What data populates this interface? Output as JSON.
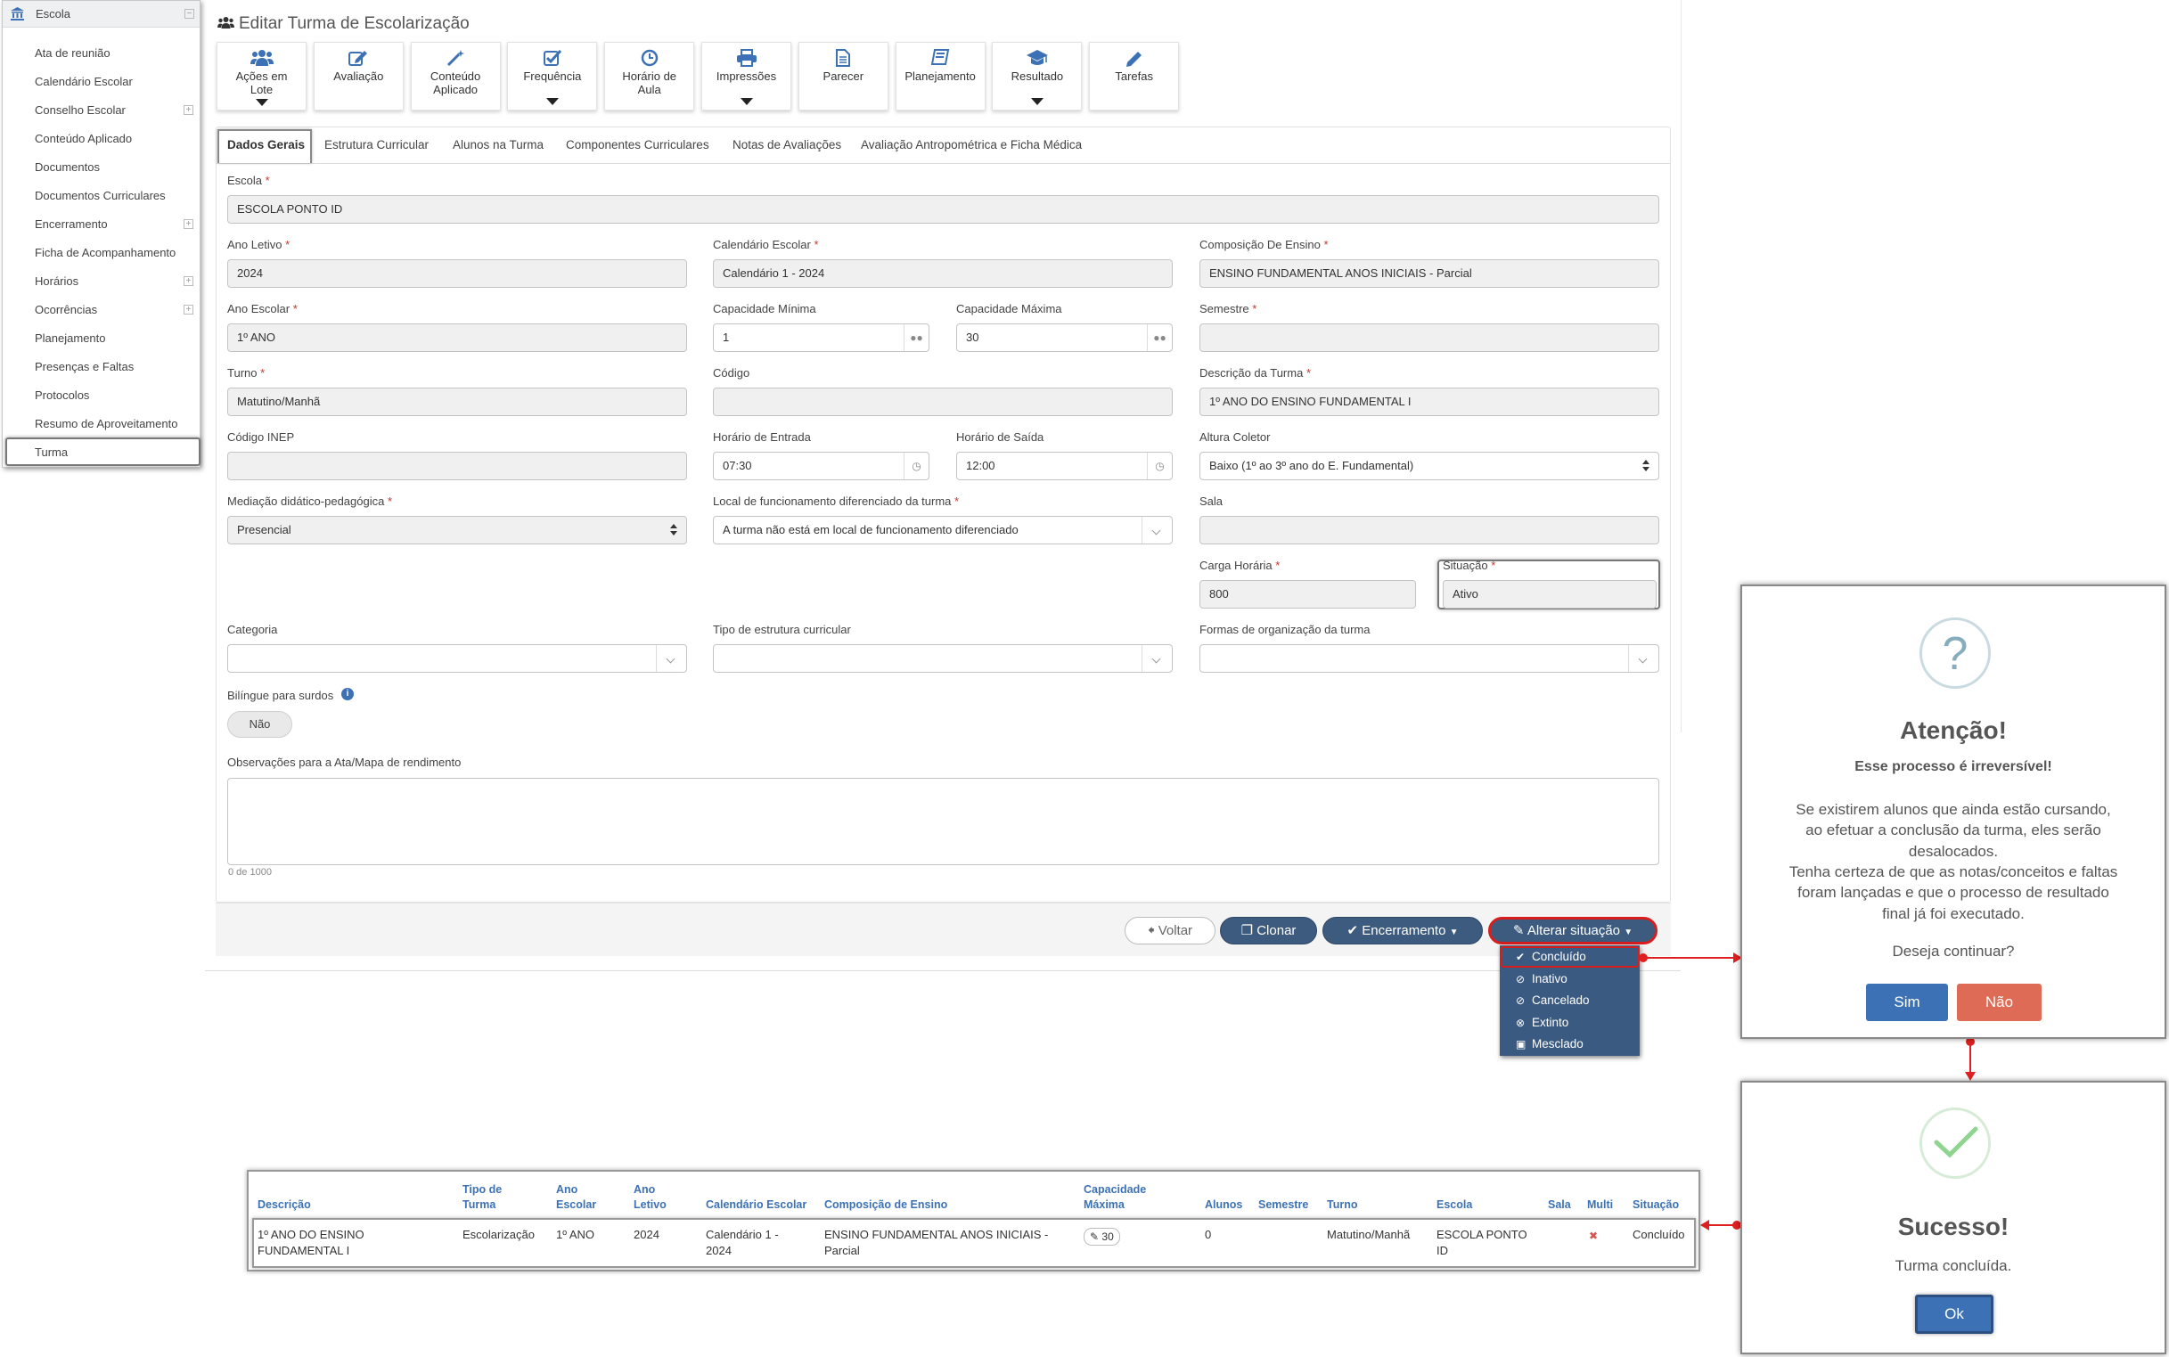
{
  "sidebar": {
    "header": "Escola",
    "items": [
      "Ata de reunião",
      "Calendário Escolar",
      "Conselho Escolar",
      "Conteúdo Aplicado",
      "Documentos",
      "Documentos Curriculares",
      "Encerramento",
      "Ficha de Acompanhamento",
      "Horários",
      "Ocorrências",
      "Planejamento",
      "Presenças e Faltas",
      "Protocolos",
      "Resumo de Aproveitamento",
      "Turma"
    ],
    "expandable": [
      "Conselho Escolar",
      "Encerramento",
      "Horários",
      "Ocorrências"
    ],
    "active": "Turma"
  },
  "page": {
    "title": "Editar Turma de Escolarização"
  },
  "toolbar": [
    {
      "l1": "Ações em",
      "l2": "Lote",
      "icon": "users-icon",
      "caret": true
    },
    {
      "l1": "Avaliação",
      "l2": "",
      "icon": "edit-icon",
      "caret": false
    },
    {
      "l1": "Conteúdo",
      "l2": "Aplicado",
      "icon": "magic-wand-icon",
      "caret": false
    },
    {
      "l1": "Frequência",
      "l2": "",
      "icon": "check-square-icon",
      "caret": true
    },
    {
      "l1": "Horário de",
      "l2": "Aula",
      "icon": "clock-icon",
      "caret": false
    },
    {
      "l1": "Impressões",
      "l2": "",
      "icon": "print-icon",
      "caret": true
    },
    {
      "l1": "Parecer",
      "l2": "",
      "icon": "document-icon",
      "caret": false
    },
    {
      "l1": "Planejamento",
      "l2": "",
      "icon": "book-icon",
      "caret": false
    },
    {
      "l1": "Resultado",
      "l2": "",
      "icon": "graduation-cap-icon",
      "caret": true
    },
    {
      "l1": "Tarefas",
      "l2": "",
      "icon": "pencil-icon",
      "caret": false
    }
  ],
  "tabs": [
    "Dados Gerais",
    "Estrutura Curricular",
    "Alunos na Turma",
    "Componentes Curriculares",
    "Notas de Avaliações",
    "Avaliação Antropométrica e Ficha Médica"
  ],
  "form": {
    "escola": {
      "label": "Escola",
      "value": "ESCOLA PONTO ID"
    },
    "ano_letivo": {
      "label": "Ano Letivo",
      "value": "2024"
    },
    "calendario": {
      "label": "Calendário Escolar",
      "value": "Calendário 1 - 2024"
    },
    "composicao": {
      "label": "Composição De Ensino",
      "value": "ENSINO FUNDAMENTAL ANOS INICIAIS - Parcial"
    },
    "ano_escolar": {
      "label": "Ano Escolar",
      "value": "1º ANO"
    },
    "cap_min": {
      "label": "Capacidade Mínima",
      "value": "1"
    },
    "cap_max": {
      "label": "Capacidade Máxima",
      "value": "30"
    },
    "semestre": {
      "label": "Semestre",
      "value": ""
    },
    "turno": {
      "label": "Turno",
      "value": "Matutino/Manhã"
    },
    "codigo": {
      "label": "Código",
      "value": ""
    },
    "descricao": {
      "label": "Descrição da Turma",
      "value": "1º ANO DO ENSINO FUNDAMENTAL I"
    },
    "inep": {
      "label": "Código INEP",
      "value": ""
    },
    "entrada": {
      "label": "Horário de Entrada",
      "value": "07:30"
    },
    "saida": {
      "label": "Horário de Saída",
      "value": "12:00"
    },
    "altura": {
      "label": "Altura Coletor",
      "value": "Baixo (1º ao 3º ano do E. Fundamental)"
    },
    "mediacao": {
      "label": "Mediação didático-pedagógica",
      "value": "Presencial"
    },
    "local": {
      "label": "Local de funcionamento diferenciado da turma",
      "value": "A turma não está em local de funcionamento diferenciado"
    },
    "sala": {
      "label": "Sala",
      "value": ""
    },
    "carga": {
      "label": "Carga Horária",
      "value": "800"
    },
    "situacao": {
      "label": "Situação",
      "value": "Ativo"
    },
    "categoria": {
      "label": "Categoria",
      "value": ""
    },
    "tipo_estrutura": {
      "label": "Tipo de estrutura curricular",
      "value": ""
    },
    "formas": {
      "label": "Formas de organização da turma",
      "value": ""
    },
    "bilingue": {
      "label": "Bilíngue para surdos",
      "value": "Não"
    },
    "obs": {
      "label": "Observações para a Ata/Mapa de rendimento",
      "counter": "0 de 1000"
    }
  },
  "actions": {
    "voltar": "Voltar",
    "clonar": "Clonar",
    "encerramento": "Encerramento",
    "alterar": "Alterar situação"
  },
  "menu": [
    "Concluído",
    "Inativo",
    "Cancelado",
    "Extinto",
    "Mesclado"
  ],
  "confirm": {
    "title": "Atenção!",
    "subtitle": "Esse processo é irreversível!",
    "lines": [
      "Se existirem alunos que ainda estão cursando,",
      "ao efetuar a conclusão da turma, eles serão",
      "desalocados.",
      "Tenha certeza de que as notas/conceitos e faltas",
      "foram lançadas e que o processo de resultado",
      "final já foi executado."
    ],
    "question": "Deseja continuar?",
    "yes": "Sim",
    "no": "Não"
  },
  "success": {
    "title": "Sucesso!",
    "message": "Turma concluída.",
    "ok": "Ok"
  },
  "table": {
    "headers": {
      "descricao": [
        "Descrição"
      ],
      "tipo": [
        "Tipo de",
        "Turma"
      ],
      "ano_escolar": [
        "Ano",
        "Escolar"
      ],
      "ano_letivo": [
        "Ano",
        "Letivo"
      ],
      "calendario": [
        "Calendário Escolar"
      ],
      "composicao": [
        "Composição de Ensino"
      ],
      "capacidade": [
        "Capacidade",
        "Máxima"
      ],
      "alunos": [
        "Alunos"
      ],
      "semestre": [
        "Semestre"
      ],
      "turno": [
        "Turno"
      ],
      "escola": [
        "Escola"
      ],
      "sala": [
        "Sala"
      ],
      "multi": [
        "Multi"
      ],
      "situacao": [
        "Situação"
      ]
    },
    "row": {
      "descricao": [
        "1º ANO DO ENSINO",
        "FUNDAMENTAL I"
      ],
      "tipo": [
        "Escolarização"
      ],
      "ano_escolar": [
        "1º ANO"
      ],
      "ano_letivo": [
        "2024"
      ],
      "calendario": [
        "Calendário 1 -",
        "2024"
      ],
      "composicao": [
        "ENSINO FUNDAMENTAL ANOS INICIAIS -",
        "Parcial"
      ],
      "capacidade": "30",
      "alunos": [
        "0"
      ],
      "semestre": [
        ""
      ],
      "turno": [
        "Matutino/Manhã"
      ],
      "escola": [
        "ESCOLA PONTO",
        "ID"
      ],
      "sala": [
        ""
      ],
      "multi": "✖",
      "situacao": [
        "Concluído"
      ]
    }
  },
  "colors": {
    "primary": "#3d5b7e",
    "brand_blue": "#3c72b5",
    "danger": "#d9534f",
    "highlight": "#e02020",
    "success": "#6ac46c"
  }
}
